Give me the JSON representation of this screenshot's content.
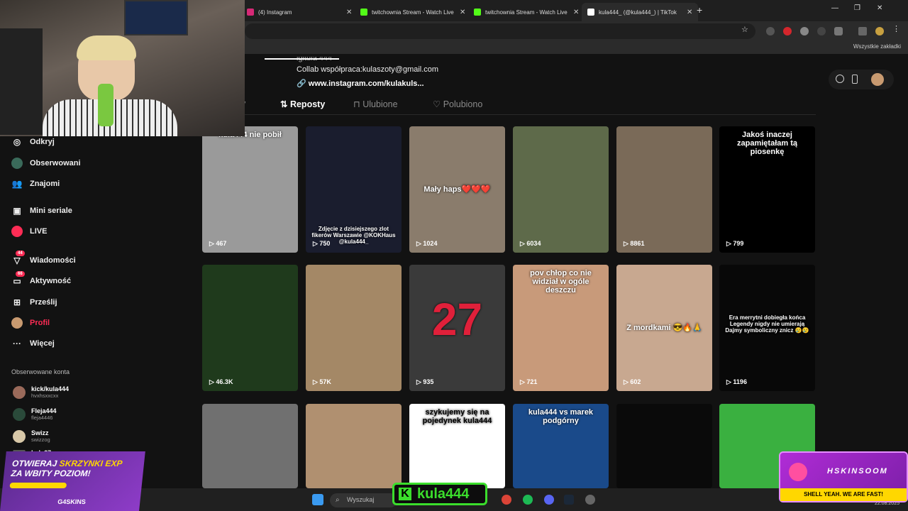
{
  "browser": {
    "tabs": [
      {
        "title": "(4) Instagram",
        "icon": "instagram-icon",
        "color": "#d62976"
      },
      {
        "title": "twitchownia Stream - Watch Live",
        "icon": "kick-icon",
        "color": "#53fc18"
      },
      {
        "title": "twitchownia Stream - Watch Live",
        "icon": "kick-icon",
        "color": "#53fc18"
      },
      {
        "title": "kula444_ (@kula444_) | TikTok",
        "icon": "tiktok-icon",
        "color": "#ffffff"
      }
    ],
    "bookmarks_label": "Wszystkie zakładki"
  },
  "profile": {
    "bio_top": "lgitula 444",
    "bio_line": "Collab współpraca:kulaszoty@gmail.com",
    "link": "www.instagram.com/kulakuls..."
  },
  "profile_tabs": [
    {
      "label": "Filmy",
      "visible": "y",
      "active": false
    },
    {
      "label": "Reposty",
      "active": true
    },
    {
      "label": "Ulubione",
      "active": false
    },
    {
      "label": "Polubiono",
      "active": false
    }
  ],
  "sidebar": {
    "items": [
      {
        "label": "Odkryj",
        "icon": "compass-icon"
      },
      {
        "label": "Obserwowani",
        "icon": "following-icon"
      },
      {
        "label": "Znajomi",
        "icon": "friends-icon"
      },
      {
        "label": "Mini seriale",
        "icon": "series-icon"
      },
      {
        "label": "LIVE",
        "icon": "live-icon"
      },
      {
        "label": "Wiadomości",
        "icon": "messages-icon",
        "badge": "44"
      },
      {
        "label": "Aktywność",
        "icon": "activity-icon",
        "badge": "66"
      },
      {
        "label": "Prześlij",
        "icon": "upload-icon"
      },
      {
        "label": "Profil",
        "icon": "avatar"
      },
      {
        "label": "Więcej",
        "icon": "more-icon"
      }
    ],
    "following_title": "Obserwowane konta",
    "accounts": [
      {
        "name": "kick/kula444",
        "handle": "hvxhsxxcxx"
      },
      {
        "name": "Fleja444",
        "handle": "fleja4446"
      },
      {
        "name": "Swizz",
        "handle": "swizzog"
      },
      {
        "name": "kula67",
        "handle": ""
      }
    ]
  },
  "videos": [
    {
      "views": "467",
      "caption": "kula444 nie pobił",
      "bg": "#9a9a9a"
    },
    {
      "views": "750",
      "caption": "Zdjęcie z dzisiejszego zlot fikerów Warszawie @KOKHaus @kula444_",
      "bg": "#1a1d2e"
    },
    {
      "views": "1024",
      "caption": "Mały haps❤️❤️❤️",
      "bg": "#8a7c6c"
    },
    {
      "views": "6034",
      "caption": "",
      "bg": "#5e6a4a"
    },
    {
      "views": "8861",
      "caption": "",
      "bg": "#7a6a58"
    },
    {
      "views": "799",
      "caption": "Jakoś inaczej zapamiętałam tą piosenkę",
      "bg": "#000000"
    },
    {
      "views": "46.3K",
      "caption": "",
      "bg": "#1f3a1c"
    },
    {
      "views": "57K",
      "caption": "",
      "bg": "#a48866"
    },
    {
      "views": "935",
      "caption": "27",
      "bg": "#3a3a3a"
    },
    {
      "views": "721",
      "caption": "pov chłop co nie widział w ogóle deszczu",
      "bg": "#c89a7a"
    },
    {
      "views": "602",
      "caption": "Z mordkami 😎🔥🙏",
      "bg": "#c8a890"
    },
    {
      "views": "1196",
      "caption": "Era merrytni dobiegła końca Legendy nigdy nie umierają Dajmy symboliczny znicz 😢😢",
      "bg": "#080808"
    },
    {
      "views": "",
      "caption": "",
      "bg": "#707070"
    },
    {
      "views": "",
      "caption": "",
      "bg": "#b09070"
    },
    {
      "views": "",
      "caption": "szykujemy się na pojedynek kula444",
      "bg": "#ffffff"
    },
    {
      "views": "",
      "caption": "kula444 vs marek podgórny",
      "bg": "#1a4a8a"
    },
    {
      "views": "",
      "caption": "",
      "bg": "#0a0a0a"
    },
    {
      "views": "",
      "caption": "",
      "bg": "#3ab040"
    }
  ],
  "overlay": {
    "streamer_name": "kula444",
    "promo_left_line1": "OTWIERAJ",
    "promo_left_accent": "SKRZYNKI EXP",
    "promo_left_line2": "ZA WBITY POZIOM!",
    "promo_left_brand": "G4SKINS",
    "promo_right_brand": "HSKINSOOM",
    "promo_right_slogan": "SHELL YEAH. WE ARE FAST!"
  },
  "taskbar": {
    "search_placeholder": "Wyszukaj",
    "date": "22.08.2025"
  }
}
